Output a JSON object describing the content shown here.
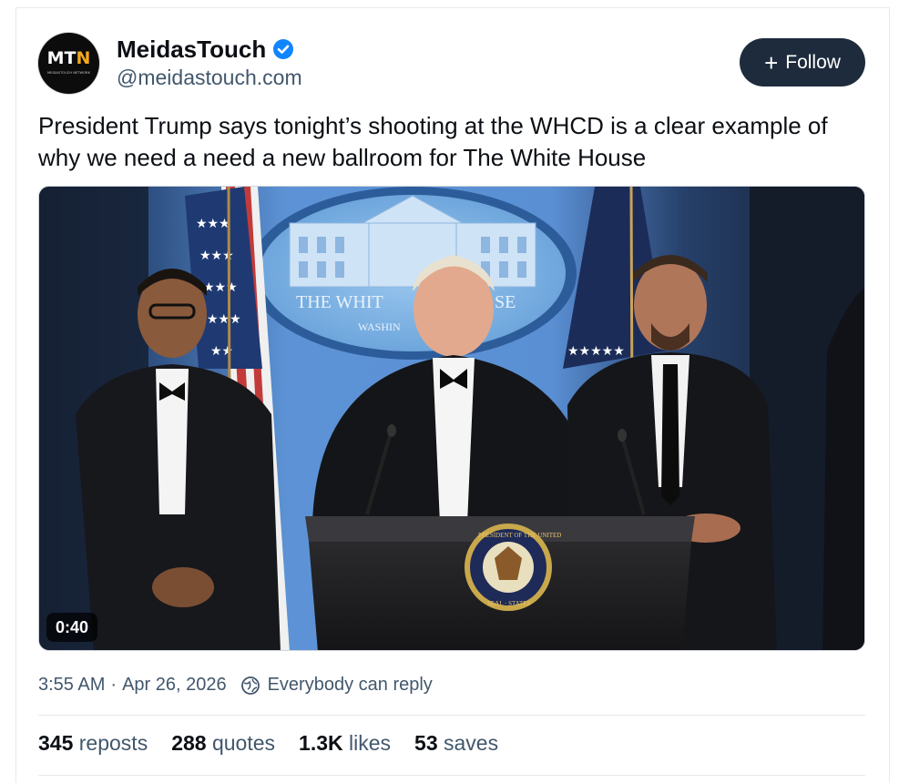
{
  "author": {
    "display_name": "MeidasTouch",
    "handle": "@meidastouch.com",
    "verified": true,
    "avatar": {
      "logo_main": "MT",
      "logo_accent": "N",
      "network": "MEIDASTOUCH NETWORK"
    }
  },
  "follow_button": {
    "icon": "+",
    "label": "Follow"
  },
  "post": {
    "text": "President Trump says tonight’s shooting at the WHCD is a clear example of why we need a need a new ballroom for The White House"
  },
  "video": {
    "duration": "0:40",
    "backdrop_text_top": "THE WHIT",
    "backdrop_text_top2": "SE",
    "backdrop_text_bottom": "WASHIN",
    "seal_top": "PRESIDENT OF THE UNITED",
    "seal_bottom": "SEAL · STATES"
  },
  "meta": {
    "time": "3:55 AM",
    "separator": "·",
    "date": "Apr 26, 2026",
    "reply_setting": "Everybody can reply"
  },
  "stats": [
    {
      "count": "345",
      "label": "reposts"
    },
    {
      "count": "288",
      "label": "quotes"
    },
    {
      "count": "1.3K",
      "label": "likes"
    },
    {
      "count": "53",
      "label": "saves"
    }
  ],
  "colors": {
    "follow_bg": "#1e2b3c",
    "verified": "#1185fe",
    "muted": "#42576c"
  }
}
